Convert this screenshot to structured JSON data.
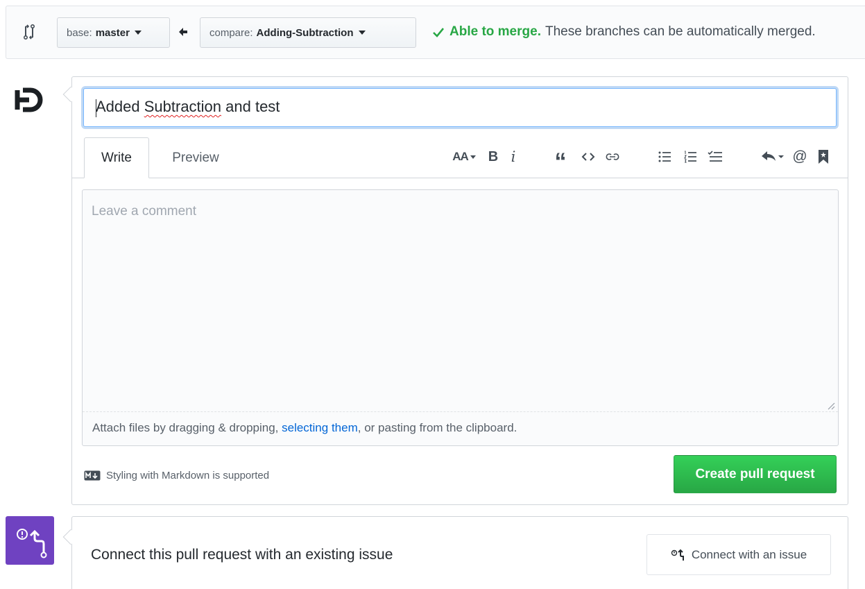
{
  "range_bar": {
    "base_prefix": "base:",
    "base_branch": "master",
    "compare_prefix": "compare:",
    "compare_branch": "Adding-Subtraction",
    "merge_ok": "Able to merge.",
    "merge_detail": "These branches can be automatically merged."
  },
  "form": {
    "title_value": "Added Subtraction and test",
    "title_word_1": "Added ",
    "title_word_2": "Subtraction",
    "title_word_3": " and test",
    "tabs": [
      {
        "label": "Write"
      },
      {
        "label": "Preview"
      }
    ],
    "toolbar": {
      "header_icon_text": "AA",
      "bold_icon_text": "B",
      "italic_icon_text": "i",
      "quote_icon_text": "“",
      "mention_icon_text": "@"
    },
    "comment_placeholder": "Leave a comment",
    "attach_before": "Attach files by dragging & dropping, ",
    "attach_link": "selecting them",
    "attach_after": ", or pasting from the clipboard.",
    "markdown_note": "Styling with Markdown is supported",
    "create_label": "Create pull request"
  },
  "issue": {
    "title": "Connect this pull request with an existing issue",
    "connect_label": "Connect with an issue"
  },
  "colors": {
    "success": "#28a745",
    "link": "#0366d6",
    "issue_badge": "#6f42c1"
  }
}
